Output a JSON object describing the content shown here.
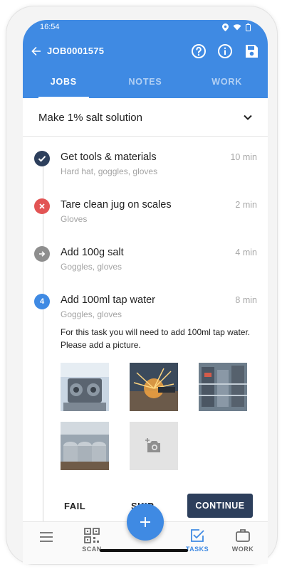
{
  "status_bar": {
    "time": "16:54"
  },
  "header": {
    "job_id": "JOB0001575"
  },
  "tabs": [
    {
      "label": "JOBS",
      "active": true
    },
    {
      "label": "NOTES",
      "active": false
    },
    {
      "label": "WORK",
      "active": false
    }
  ],
  "job_selector": {
    "value": "Make 1% salt solution"
  },
  "tasks": [
    {
      "title": "Get tools & materials",
      "subtitle": "Hard hat, goggles, gloves",
      "duration": "10 min",
      "status": "done"
    },
    {
      "title": "Tare clean jug on scales",
      "subtitle": "Gloves",
      "duration": "2 min",
      "status": "failed"
    },
    {
      "title": "Add 100g salt",
      "subtitle": "Goggles, gloves",
      "duration": "4 min",
      "status": "skipped"
    },
    {
      "title": "Add 100ml tap water",
      "subtitle": "Goggles, gloves",
      "duration": "8 min",
      "status": "current",
      "number": "4",
      "description": "For this task you will need to add 100ml tap water. Please add a picture."
    }
  ],
  "actions": {
    "fail": "FAIL",
    "skip": "SKIP",
    "continue": "CONTINUE"
  },
  "bottom_nav": {
    "scan": "SCAN",
    "tasks": "TASKS",
    "work": "WORK"
  },
  "colors": {
    "primary": "#3f8ae3",
    "dark_navy": "#2d3f5c",
    "failed_red": "#e25454",
    "skipped_gray": "#8e8e8e"
  }
}
